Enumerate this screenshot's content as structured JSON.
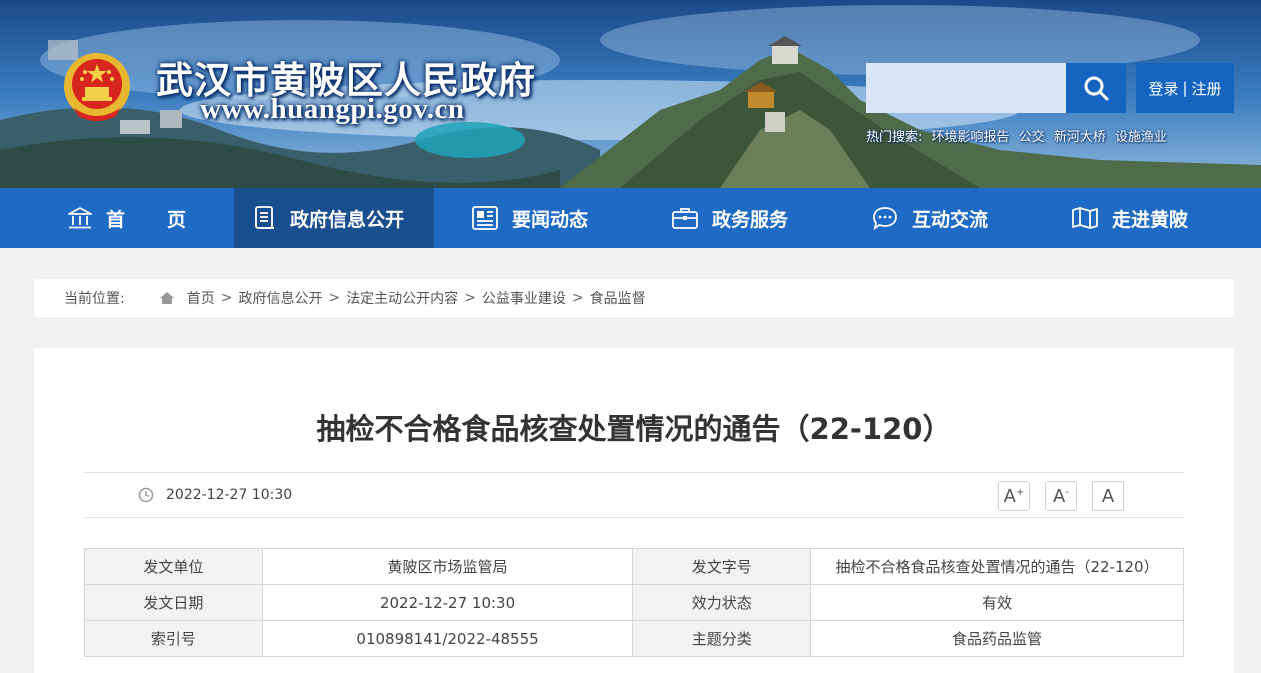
{
  "header": {
    "site_title": "武汉市黄陂区人民政府",
    "site_url": "www.huangpi.gov.cn",
    "search_placeholder": "",
    "login": "登录",
    "auth_separator": "|",
    "register": "注册",
    "hot_label": "热门搜索:",
    "hot_terms": [
      "环境影响报告",
      "公交",
      "新河大桥",
      "设施渔业"
    ]
  },
  "nav": {
    "items": [
      {
        "label": "首页",
        "icon": "bank-icon"
      },
      {
        "label": "政府信息公开",
        "icon": "document-list-icon",
        "active": true
      },
      {
        "label": "要闻动态",
        "icon": "newspaper-icon"
      },
      {
        "label": "政务服务",
        "icon": "briefcase-icon"
      },
      {
        "label": "互动交流",
        "icon": "chat-bubble-icon"
      },
      {
        "label": "走进黄陂",
        "icon": "map-book-icon"
      }
    ]
  },
  "breadcrumb": {
    "label": "当前位置:",
    "separator": ">",
    "items": [
      "首页",
      "政府信息公开",
      "法定主动公开内容",
      "公益事业建设",
      "食品监督"
    ]
  },
  "article": {
    "title": "抽检不合格食品核查处置情况的通告（22-120）",
    "date": "2022-12-27 10:30",
    "font_controls": {
      "larger": "A",
      "larger_mark": "+",
      "smaller": "A",
      "smaller_mark": "-",
      "reset": "A"
    }
  },
  "info_table": {
    "rows": [
      [
        "发文单位",
        "黄陂区市场监管局",
        "发文字号",
        "抽检不合格食品核查处置情况的通告（22-120）"
      ],
      [
        "发文日期",
        "2022-12-27 10:30",
        "效力状态",
        "有效"
      ],
      [
        "索引号",
        "010898141/2022-48555",
        "主题分类",
        "食品药品监管"
      ]
    ]
  },
  "colors": {
    "nav_bg": "#1e6ac4",
    "nav_active": "#1a4f8f",
    "accent": "#1565c0",
    "page_bg": "#f1f1f1"
  }
}
